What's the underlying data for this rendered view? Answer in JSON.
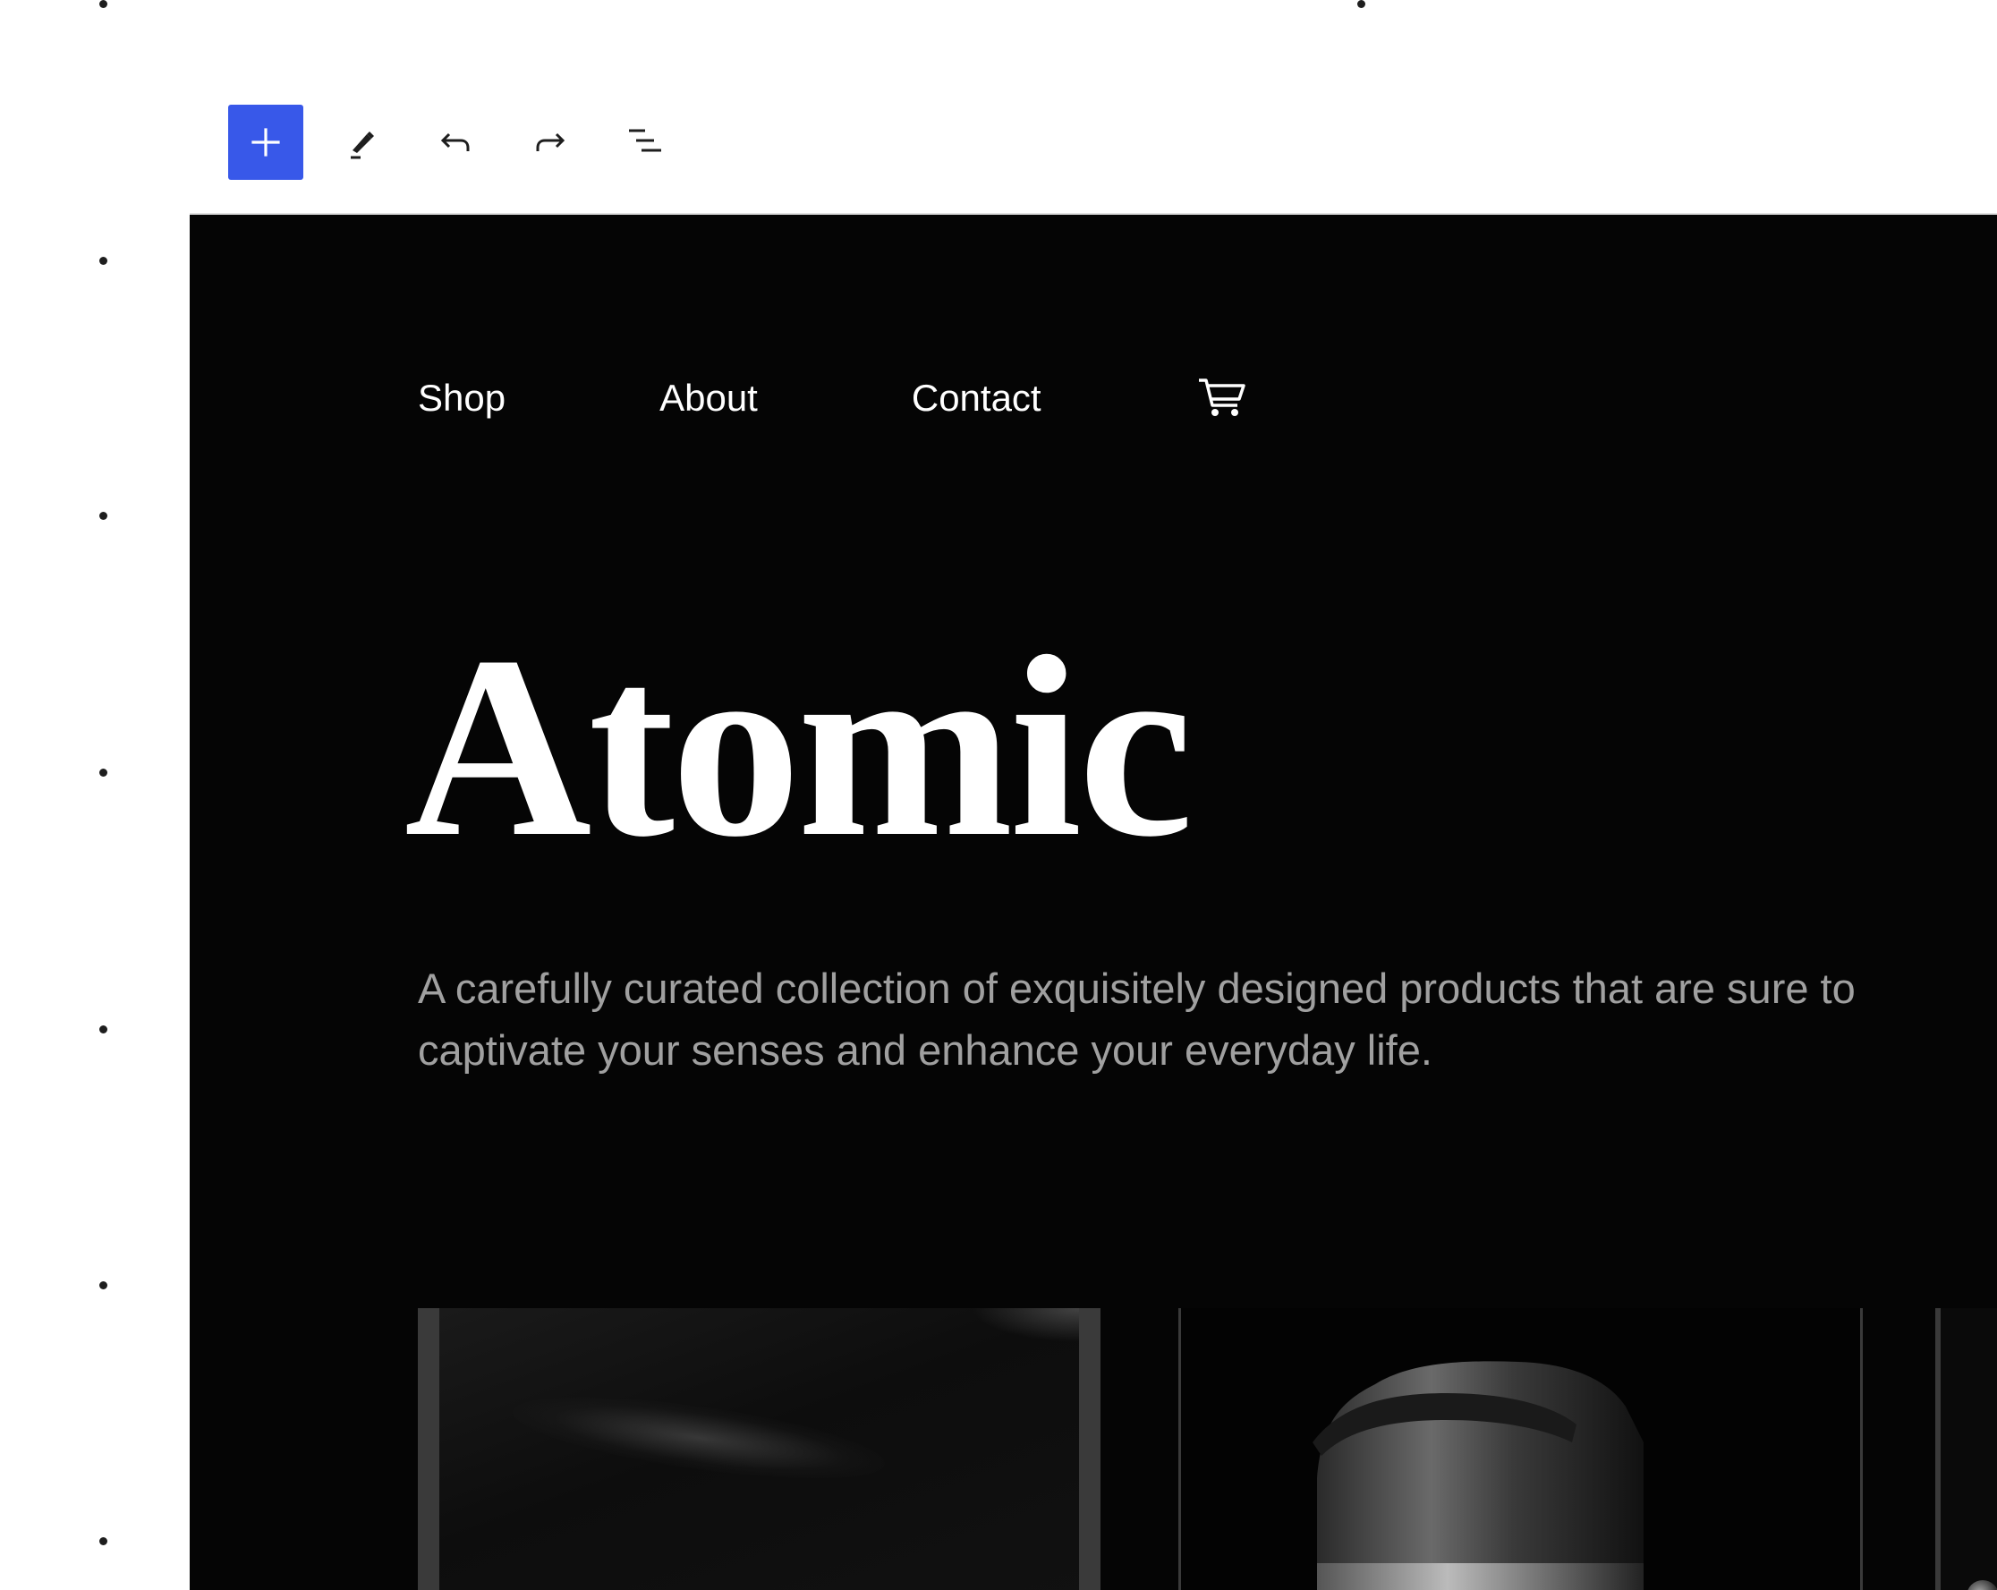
{
  "toolbar": {
    "add_block": {
      "icon": "plus-icon",
      "color": "#3858e9"
    },
    "tools": [
      {
        "name": "edit-tool",
        "icon": "pencil-icon"
      },
      {
        "name": "undo",
        "icon": "undo-icon"
      },
      {
        "name": "redo",
        "icon": "redo-icon"
      },
      {
        "name": "document-overview",
        "icon": "list-view-icon"
      }
    ]
  },
  "site": {
    "nav": {
      "shop": "Shop",
      "about": "About",
      "contact": "Contact",
      "cart_icon": "cart-icon"
    },
    "title": "Atomic",
    "subtitle": "A carefully curated collection of exquisitely designed products that are sure to captivate your senses and enhance your everyday life.",
    "background_color": "#050505",
    "text_color": "#ffffff",
    "subtitle_color": "#a0a0a0"
  }
}
